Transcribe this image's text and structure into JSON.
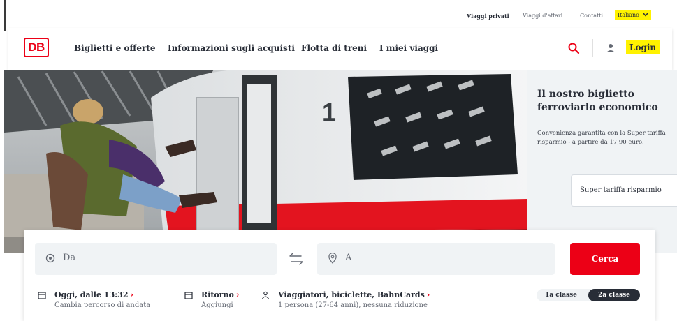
{
  "topbar": {
    "links": [
      {
        "label": "Viaggi privati",
        "active": true
      },
      {
        "label": "Viaggi d'affari",
        "active": false
      },
      {
        "label": "Contatti",
        "active": false
      }
    ],
    "language": "Italiano"
  },
  "header": {
    "logo": "DB",
    "nav": [
      "Biglietti e offerte",
      "Informazioni sugli acquisti",
      "Flotta di treni",
      "I miei viaggi"
    ],
    "login": "Login"
  },
  "hero": {
    "car_number": "1"
  },
  "promo": {
    "title": "Il nostro biglietto ferroviario economico",
    "description": "Convenienza garantita con la Super tariffa risparmio - a partire da 17,90 euro.",
    "button": "Super tariffa risparmio"
  },
  "booking": {
    "from_placeholder": "Da",
    "to_placeholder": "A",
    "search_button": "Cerca",
    "options": [
      {
        "title": "Oggi, dalle 13:32",
        "subtitle": "Cambia percorso di andata"
      },
      {
        "title": "Ritorno",
        "subtitle": "Aggiungi"
      },
      {
        "title": "Viaggiatori, biciclette, BahnCards",
        "subtitle": "1 persona (27-64 anni), nessuna riduzione"
      }
    ],
    "classes": [
      "1a classe",
      "2a classe"
    ],
    "selected_class": "2a classe"
  },
  "colors": {
    "brand_red": "#ec0016",
    "highlight_yellow": "#fff200",
    "text_dark": "#282d37",
    "field_bg": "#f0f3f5"
  },
  "icons": [
    "search-icon",
    "user-icon",
    "chevron-down-icon",
    "origin-circle-icon",
    "location-pin-icon",
    "swap-arrows-icon",
    "calendar-icon",
    "person-icon",
    "chevron-right-icon"
  ]
}
